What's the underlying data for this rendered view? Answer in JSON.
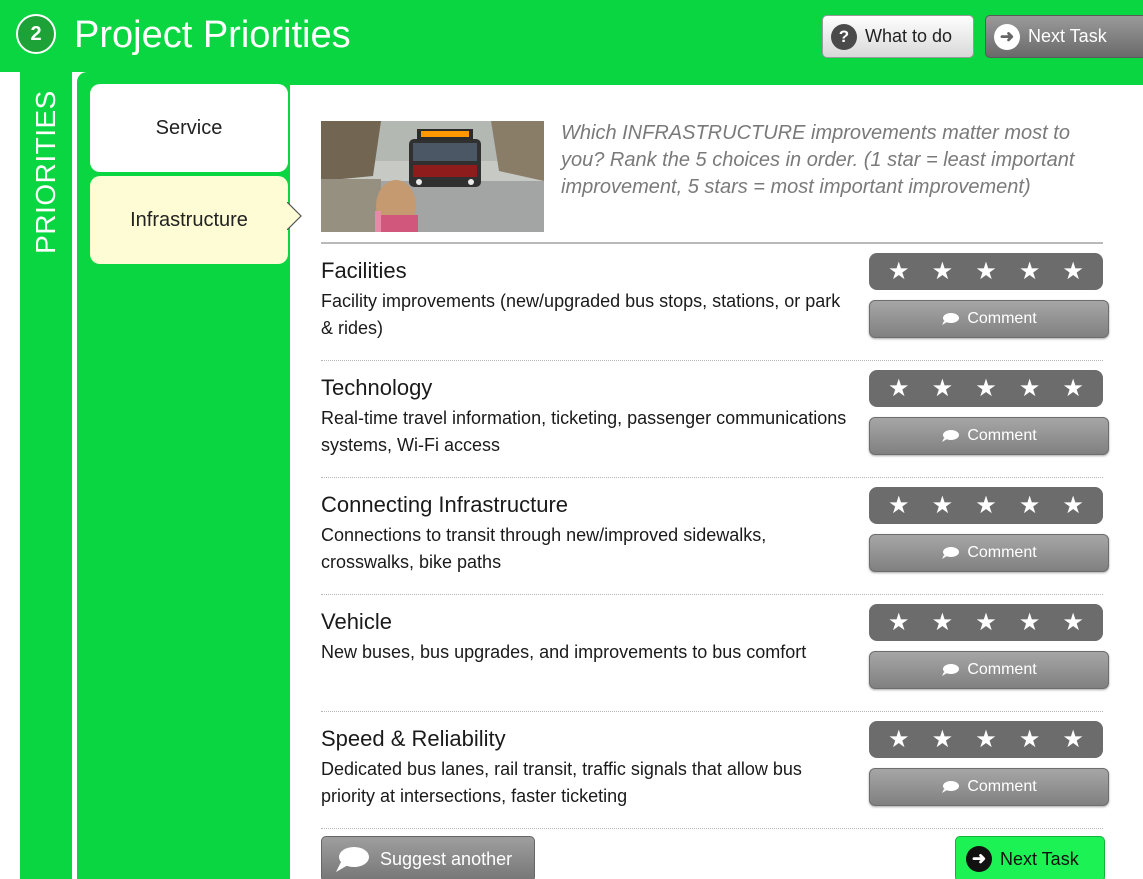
{
  "header": {
    "step_number": "2",
    "title": "Project Priorities",
    "what_to_do_label": "What to do",
    "next_task_label": "Next Task"
  },
  "sidebar": {
    "vertical_label": "PRIORITIES",
    "tabs": [
      {
        "label": "Service",
        "selected": false
      },
      {
        "label": "Infrastructure",
        "selected": true
      }
    ]
  },
  "main": {
    "intro": "Which INFRASTRUCTURE improvements matter most to you? Rank the 5 choices in order. (1 star = least important improvement, 5 stars = most important improvement)",
    "items": [
      {
        "title": "Facilities",
        "description": "Facility improvements (new/upgraded bus stops, stations, or park & rides)",
        "rating": 0,
        "comment_label": "Comment"
      },
      {
        "title": "Technology",
        "description": "Real-time travel information, ticketing, passenger communications systems, Wi-Fi access",
        "rating": 0,
        "comment_label": "Comment"
      },
      {
        "title": "Connecting Infrastructure",
        "description": "Connections to transit through new/improved sidewalks, crosswalks, bike paths",
        "rating": 0,
        "comment_label": "Comment"
      },
      {
        "title": "Vehicle",
        "description": "New buses, bus upgrades, and improvements to bus comfort",
        "rating": 0,
        "comment_label": "Comment"
      },
      {
        "title": "Speed & Reliability",
        "description": "Dedicated bus lanes, rail transit, traffic signals that allow bus priority at intersections, faster ticketing",
        "rating": 0,
        "comment_label": "Comment"
      }
    ],
    "suggest_label": "Suggest another",
    "next_task_label": "Next Task"
  },
  "colors": {
    "brand_green": "#09d641",
    "next_button_green": "#1cf254",
    "selected_tab": "#fdfcd4",
    "star_bar": "#6c6c6c"
  },
  "icons": {
    "help": "question-circle-icon",
    "next": "arrow-right-circle-icon",
    "comment": "speech-bubble-icon",
    "star": "star-icon"
  }
}
